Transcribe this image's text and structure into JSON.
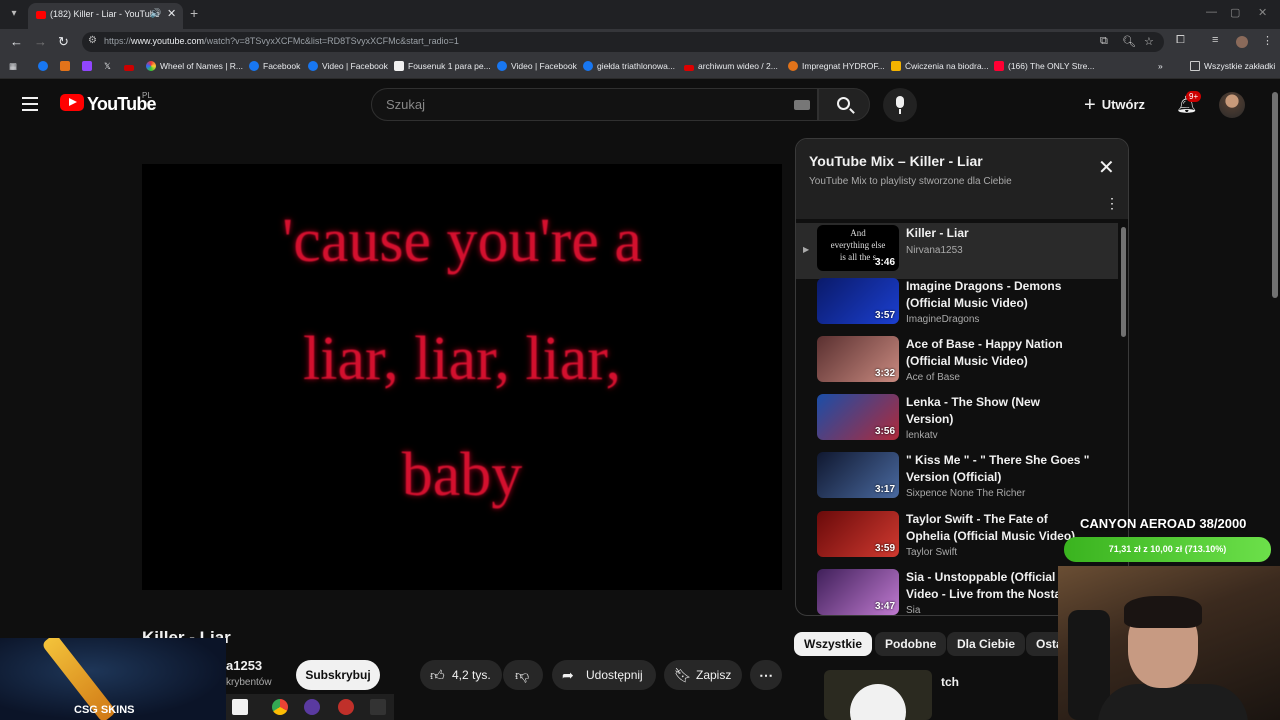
{
  "browser": {
    "tab_title": "(182) Killer - Liar - YouTube",
    "url_prefix": "https://",
    "url_host": "www.youtube.com",
    "url_path": "/watch?v=8TSvyxXCFMc&list=RD8TSvyxXCFMc&start_radio=1",
    "bookmarks": [
      "Wheel of Names | R...",
      "Facebook",
      "Video | Facebook",
      "Fousenuk 1 para pe...",
      "Video | Facebook",
      "giełda triathlonowa...",
      "archiwum wideo / 2...",
      "Impregnat HYDROF...",
      "Ćwiczenia na biodra...",
      "(166) The ONLY Stre..."
    ],
    "all_bookmarks": "Wszystkie zakładki"
  },
  "header": {
    "logo_text": "YouTube",
    "country": "PL",
    "search_placeholder": "Szukaj",
    "create_label": "Utwórz",
    "notif_count": "9+"
  },
  "video": {
    "lyrics": [
      "'cause you're a",
      "liar, liar, liar,",
      "baby"
    ],
    "title": "Killer - Liar",
    "channel": "a1253",
    "subscribers": "krybentów",
    "subscribe_label": "Subskrybuj",
    "likes": "4,2 tys.",
    "share_label": "Udostępnij",
    "save_label": "Zapisz"
  },
  "playlist": {
    "title": "YouTube Mix – Killer - Liar",
    "subtitle": "YouTube Mix to playlisty stworzone dla Ciebie",
    "items": [
      {
        "title": "Killer - Liar",
        "channel": "Nirvana1253",
        "duration": "3:46",
        "thumb_text": "And\neverything else\nis all the s",
        "colors": [
          "#000000",
          "#000000"
        ]
      },
      {
        "title": "Imagine Dragons - Demons\n(Official Music Video)",
        "channel": "ImagineDragons",
        "duration": "3:57",
        "colors": [
          "#0a1a6a",
          "#1b3fd0"
        ]
      },
      {
        "title": "Ace of Base - Happy Nation\n(Official Music Video)",
        "channel": "Ace of Base",
        "duration": "3:32",
        "colors": [
          "#5a3030",
          "#c98a80"
        ]
      },
      {
        "title": "Lenka - The Show (New\nVersion)",
        "channel": "lenkatv",
        "duration": "3:56",
        "colors": [
          "#1a4ea8",
          "#b02a3a"
        ]
      },
      {
        "title": "\" Kiss Me \" - \" There She Goes \"\nVersion (Official)",
        "channel": "Sixpence None The Richer",
        "duration": "3:17",
        "colors": [
          "#101830",
          "#4a6aa0"
        ]
      },
      {
        "title": "Taylor Swift - The Fate of\nOphelia (Official Music Video)",
        "channel": "Taylor Swift",
        "duration": "3:59",
        "colors": [
          "#6a0a0a",
          "#d03a30"
        ]
      },
      {
        "title": "Sia - Unstoppable (Official\nVideo - Live from the Nostalgi",
        "channel": "Sia",
        "duration": "3:47",
        "colors": [
          "#40205a",
          "#c07ad0"
        ]
      }
    ]
  },
  "chips": [
    "Wszystkie",
    "Podobne",
    "Dla Ciebie",
    "Osta"
  ],
  "recommendation": {
    "title_fragment": "tch"
  },
  "overlay": {
    "goal_title": "CANYON AEROAD 38/2000",
    "goal_progress": "71,31 zł z 10,00 zł (713.10%)",
    "sponsor": "CSG SKINS"
  }
}
